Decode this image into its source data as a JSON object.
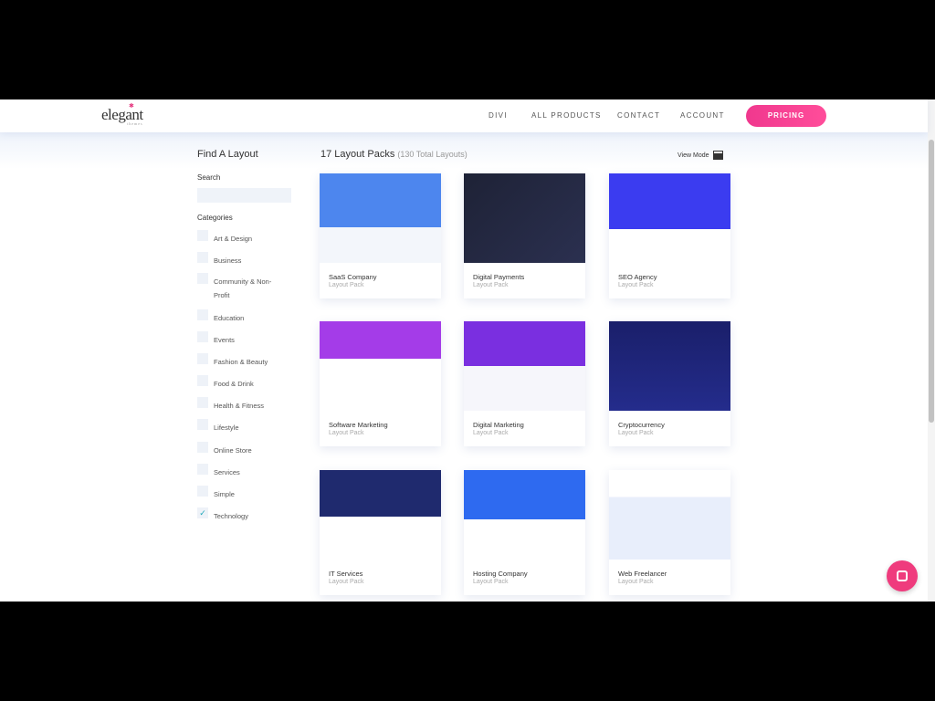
{
  "header": {
    "logo": "elegant",
    "logo_sub": "themes",
    "nav": [
      "DIVI",
      "ALL PRODUCTS",
      "CONTACT",
      "ACCOUNT"
    ],
    "pricing": "PRICING"
  },
  "sidebar": {
    "title": "Find A Layout",
    "search_label": "Search",
    "search_placeholder": "",
    "categories_label": "Categories",
    "categories": [
      {
        "label": "Art & Design",
        "checked": false
      },
      {
        "label": "Business",
        "checked": false
      },
      {
        "label": "Community & Non-Profit",
        "checked": false
      },
      {
        "label": "Education",
        "checked": false
      },
      {
        "label": "Events",
        "checked": false
      },
      {
        "label": "Fashion & Beauty",
        "checked": false
      },
      {
        "label": "Food & Drink",
        "checked": false
      },
      {
        "label": "Health & Fitness",
        "checked": false
      },
      {
        "label": "Lifestyle",
        "checked": false
      },
      {
        "label": "Online Store",
        "checked": false
      },
      {
        "label": "Services",
        "checked": false
      },
      {
        "label": "Simple",
        "checked": false
      },
      {
        "label": "Technology",
        "checked": true
      }
    ]
  },
  "main": {
    "title": "17 Layout Packs",
    "subtitle": "(130 Total Layouts)",
    "view_mode": "View Mode",
    "cards": [
      {
        "name": "SaaS Company",
        "type": "Layout Pack",
        "bg": "linear-gradient(#4d86ee 0 60%,#f3f6fb 60%)"
      },
      {
        "name": "Digital Payments",
        "type": "Layout Pack",
        "bg": "linear-gradient(135deg,#1e2236,#2b3050)"
      },
      {
        "name": "SEO Agency",
        "type": "Layout Pack",
        "bg": "linear-gradient(#3b3cf0 0 62%,#fff 62%)"
      },
      {
        "name": "Software Marketing",
        "type": "Layout Pack",
        "bg": "linear-gradient(#a43ce8 0 42%,#fff 42%)"
      },
      {
        "name": "Digital Marketing",
        "type": "Layout Pack",
        "bg": "linear-gradient(#7a2fe0 0 50%,#f6f6fb 50%)"
      },
      {
        "name": "Cryptocurrency",
        "type": "Layout Pack",
        "bg": "linear-gradient(#1a1f6a,#242c8c)"
      },
      {
        "name": "IT Services",
        "type": "Layout Pack",
        "bg": "linear-gradient(#1f2a6e 0 52%,#fff 52%)"
      },
      {
        "name": "Hosting Company",
        "type": "Layout Pack",
        "bg": "linear-gradient(#2e6af0 0 55%,#fff 55%)"
      },
      {
        "name": "Web Freelancer",
        "type": "Layout Pack",
        "bg": "linear-gradient(#fff 0 30%,#e8eefb 30%)"
      }
    ]
  },
  "colors": {
    "accent": "#f0388e",
    "check": "#22aabb"
  }
}
